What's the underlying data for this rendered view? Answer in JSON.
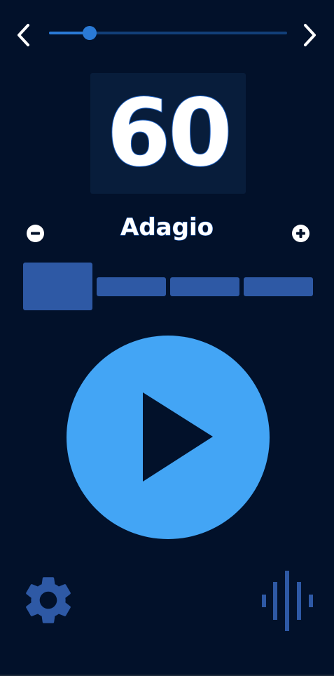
{
  "top_bar": {
    "prev_icon": "chevron-left-icon",
    "next_icon": "chevron-right-icon",
    "slider_fraction": 0.17
  },
  "bpm": {
    "value": "60"
  },
  "tempo": {
    "name": "Adagio",
    "minus_icon": "minus-circle-icon",
    "plus_icon": "plus-circle-icon"
  },
  "beats": {
    "count": 4,
    "accented_index": 0
  },
  "play": {
    "icon": "play-icon"
  },
  "bottom": {
    "settings_icon": "gear-icon",
    "sound_icon": "sound-wave-icon"
  },
  "colors": {
    "background": "#02112a",
    "accent": "#43a5f5",
    "slider": "#2a7ad6",
    "beat": "#2e59a5",
    "bpm_box": "#081d3b"
  }
}
